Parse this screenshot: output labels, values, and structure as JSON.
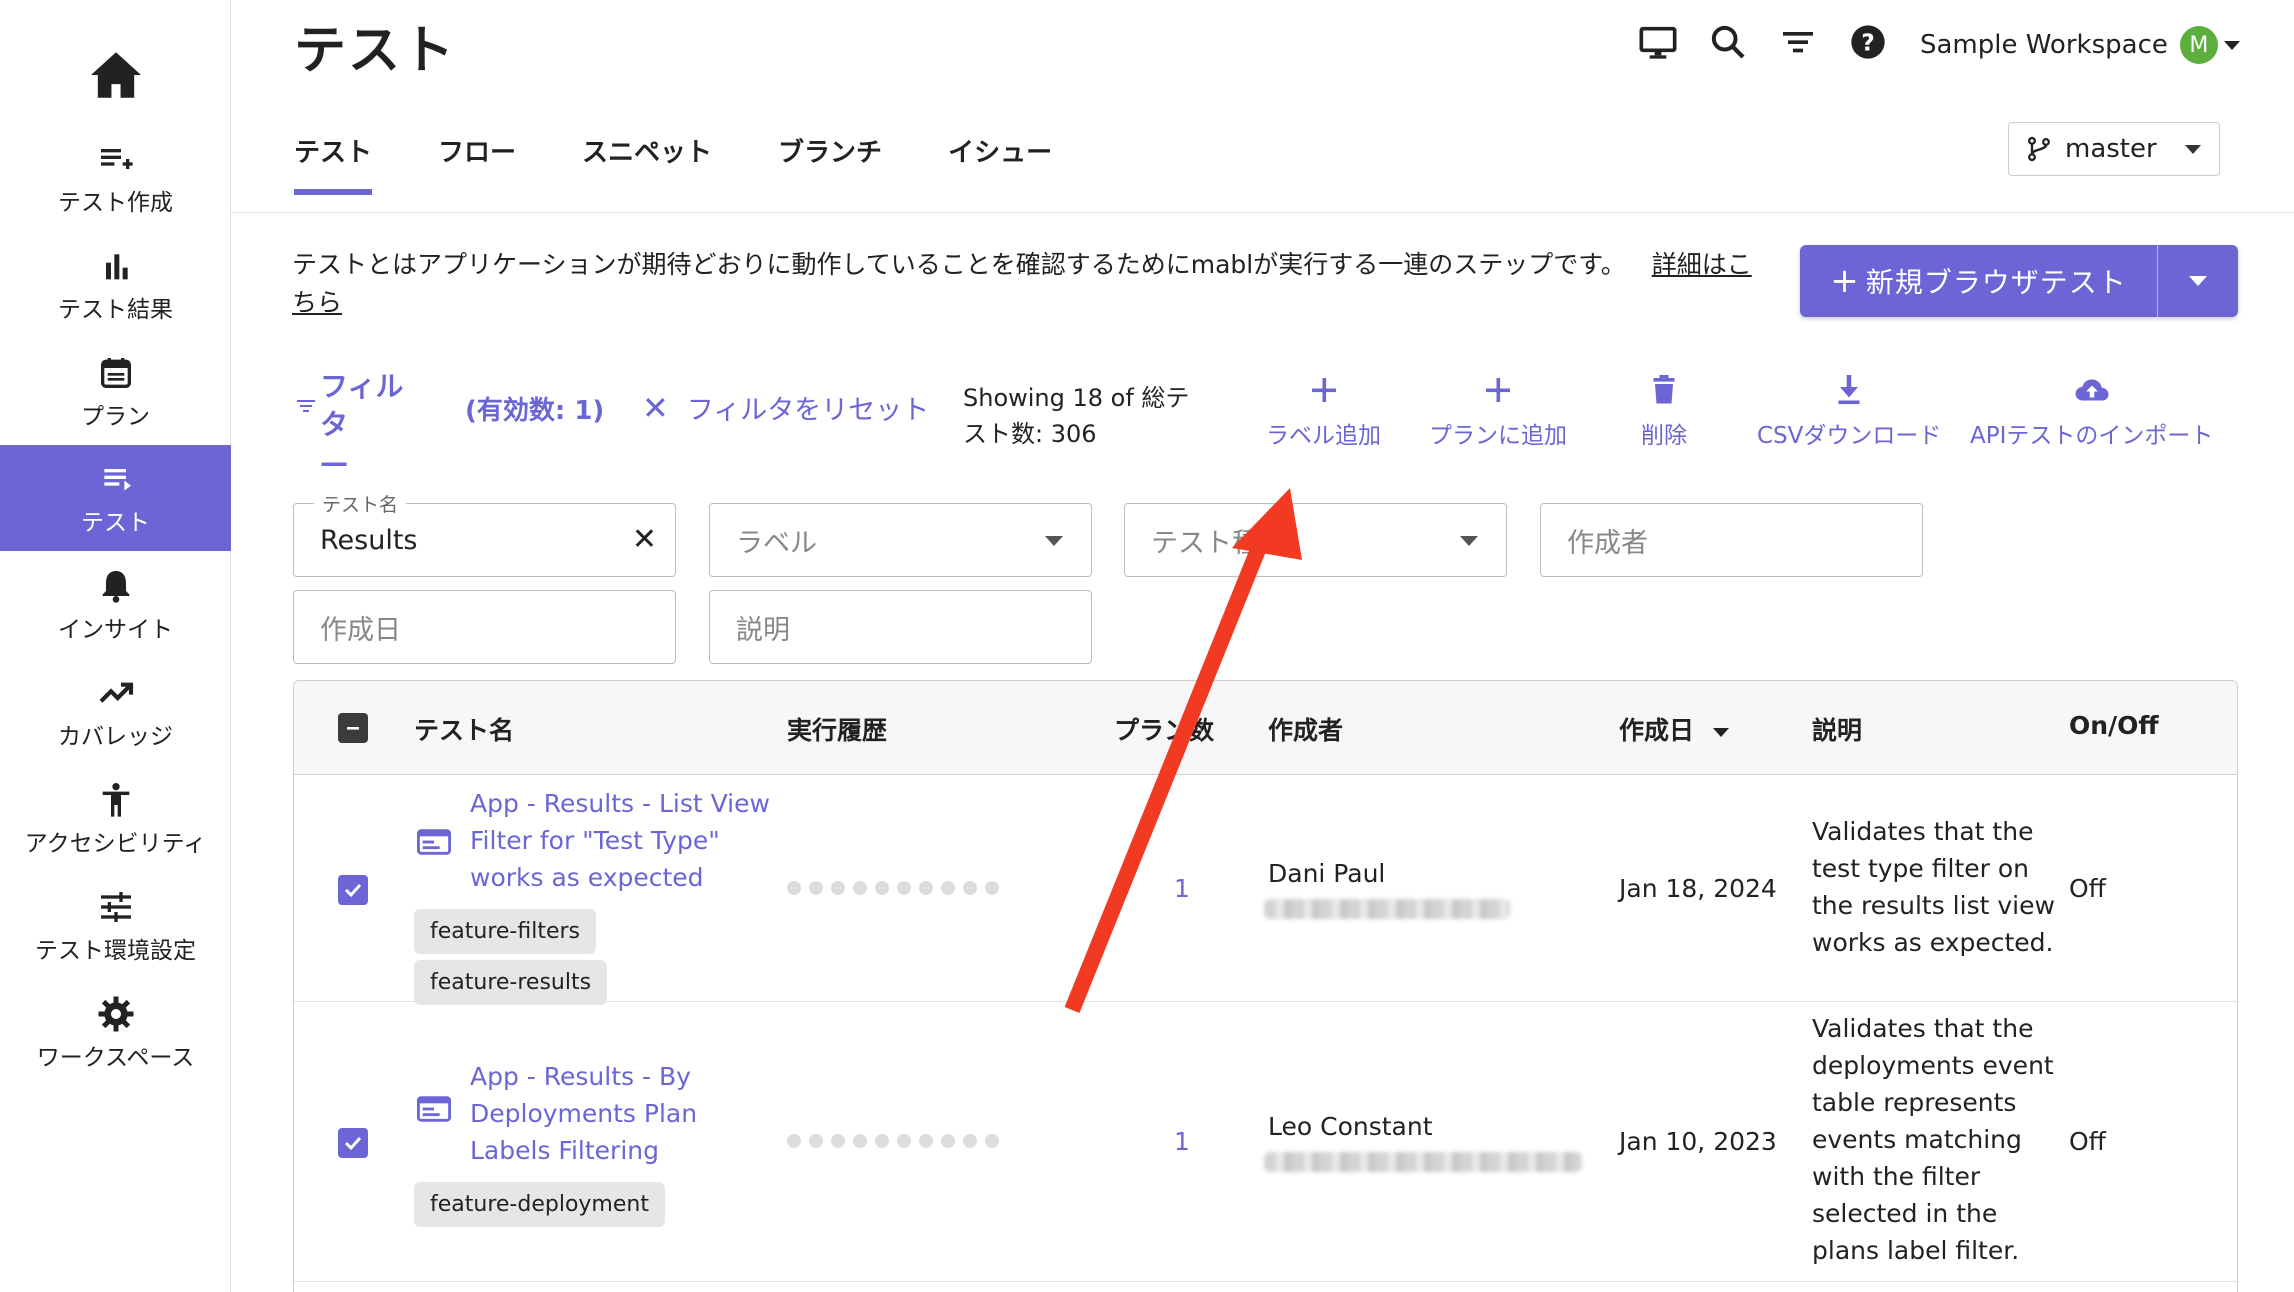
{
  "page": {
    "title": "テスト"
  },
  "sidebar": {
    "items": [
      {
        "label": "テスト作成",
        "icon": "playlist-add-icon"
      },
      {
        "label": "テスト結果",
        "icon": "bar-chart-icon"
      },
      {
        "label": "プラン",
        "icon": "calendar-icon"
      },
      {
        "label": "テスト",
        "icon": "list-icon",
        "active": true
      },
      {
        "label": "インサイト",
        "icon": "bell-icon"
      },
      {
        "label": "カバレッジ",
        "icon": "trending-up-icon"
      },
      {
        "label": "アクセシビリティ",
        "icon": "accessibility-icon"
      },
      {
        "label": "テスト環境設定",
        "icon": "sliders-icon"
      },
      {
        "label": "ワークスペース",
        "icon": "gear-icon"
      }
    ]
  },
  "header": {
    "workspace_name": "Sample Workspace",
    "avatar_initial": "M"
  },
  "tabs": [
    {
      "label": "テスト",
      "active": true
    },
    {
      "label": "フロー"
    },
    {
      "label": "スニペット"
    },
    {
      "label": "ブランチ"
    },
    {
      "label": "イシュー"
    }
  ],
  "branch": {
    "value": "master"
  },
  "description": {
    "text": "テストとはアプリケーションが期待どおりに動作していることを確認するためにmablが実行する一連のステップです。",
    "link1": "詳細はこ",
    "link2": "ちら"
  },
  "new_test_button": {
    "label": "新規ブラウザテスト"
  },
  "toolbar": {
    "filter_label": "フィルタ",
    "filter_count": "(有効数: 1)",
    "reset_label": "フィルタをリセット",
    "showing_line1": "Showing 18 of 総テ",
    "showing_line2": "スト数: 306",
    "add_label": "ラベル追加",
    "add_to_plan": "プランに追加",
    "delete": "削除",
    "csv_download": "CSVダウンロード",
    "api_import": "APIテストのインポート"
  },
  "filters": {
    "test_name_label": "テスト名",
    "test_name_value": "Results",
    "label_placeholder": "ラベル",
    "test_type_placeholder": "テスト種",
    "author_placeholder": "作成者",
    "created_placeholder": "作成日",
    "desc_placeholder": "説明"
  },
  "table": {
    "headers": {
      "name": "テスト名",
      "history": "実行履歴",
      "plans": "プラン数",
      "author": "作成者",
      "created": "作成日",
      "description": "説明",
      "onoff": "On/Off"
    },
    "rows": [
      {
        "name_lines": [
          "App - Results - List View",
          "Filter for \"Test Type\"",
          "works as expected"
        ],
        "labels": [
          "feature-filters",
          "feature-results"
        ],
        "plans": "1",
        "author": "Dani Paul",
        "created": "Jan 18, 2024",
        "description_lines": [
          "Validates that the",
          "test type filter on",
          "the results list view",
          "works as expected."
        ],
        "onoff": "Off"
      },
      {
        "name_lines": [
          "App - Results - By",
          "Deployments Plan",
          "Labels Filtering"
        ],
        "labels": [
          "feature-deployment"
        ],
        "plans": "1",
        "author": "Leo Constant",
        "created": "Jan 10, 2023",
        "description_lines": [
          "Validates that the",
          "deployments event",
          "table represents",
          "events matching",
          "with the filter",
          "selected in the",
          "plans label filter."
        ],
        "onoff": "Off"
      }
    ]
  },
  "colors": {
    "accent": "#6b65d6",
    "annotation_arrow": "#f23a22"
  }
}
